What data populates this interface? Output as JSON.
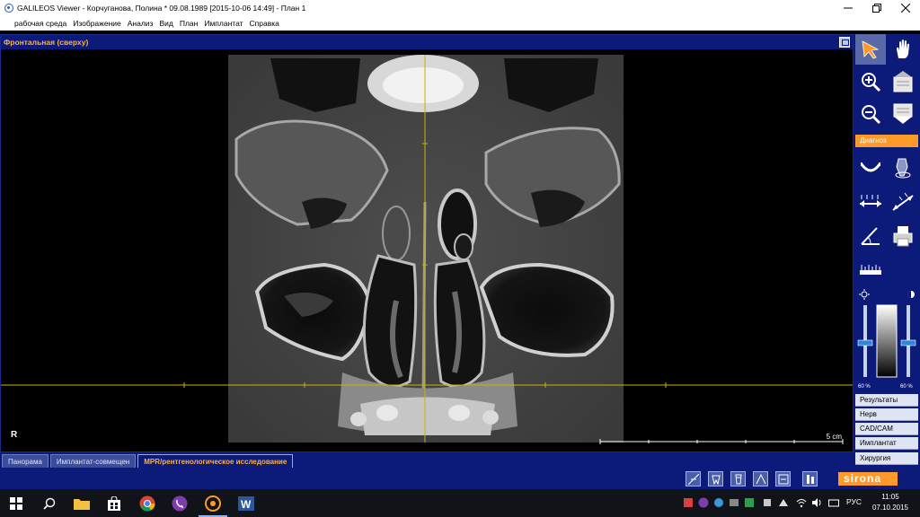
{
  "window": {
    "title": "GALILEOS Viewer - Корчуганова, Полина * 09.08.1989 [2015-10-06 14:49] - План 1",
    "controls": [
      "minimize-icon",
      "restore-icon",
      "close-icon"
    ]
  },
  "menu": {
    "items": [
      "рабочая среда",
      "Изображение",
      "Анализ",
      "Вид",
      "План",
      "Имплантат",
      "Справка"
    ]
  },
  "viewer": {
    "title": "Фронтальная (сверху)",
    "orientation": "R",
    "scale_label": "5 cm"
  },
  "tabs": [
    {
      "label": "Панорама",
      "active": false
    },
    {
      "label": "Имплантат-совмещен",
      "active": false
    },
    {
      "label": "MPR/рентгенологическое исследование",
      "active": true
    }
  ],
  "toolbar": {
    "section_label": "Диагноз",
    "side_items": [
      "Результаты",
      "Нерв",
      "CAD/CAM",
      "Имплантат",
      "Хирургия"
    ],
    "tools": [
      "pointer-arrow-icon",
      "pan-hand-icon",
      "zoom-in-icon",
      "scroll-up-icon",
      "zoom-out-icon",
      "scroll-down-icon",
      "panoramic-curve-icon",
      "implant-icon",
      "distance-measure-icon",
      "oblique-measure-icon",
      "angle-measure-icon",
      "print-icon",
      "ruler-icon"
    ],
    "slider_value_left": "60 %",
    "slider_value_right": "60 %"
  },
  "brand": "sirona",
  "taskbar": {
    "language": "РУС",
    "time": "11:05",
    "date": "07.10.2015"
  },
  "colors": {
    "panel_blue": "#0c1b7a",
    "accent_orange": "#ff9a2a",
    "crosshair": "#c8b400"
  }
}
